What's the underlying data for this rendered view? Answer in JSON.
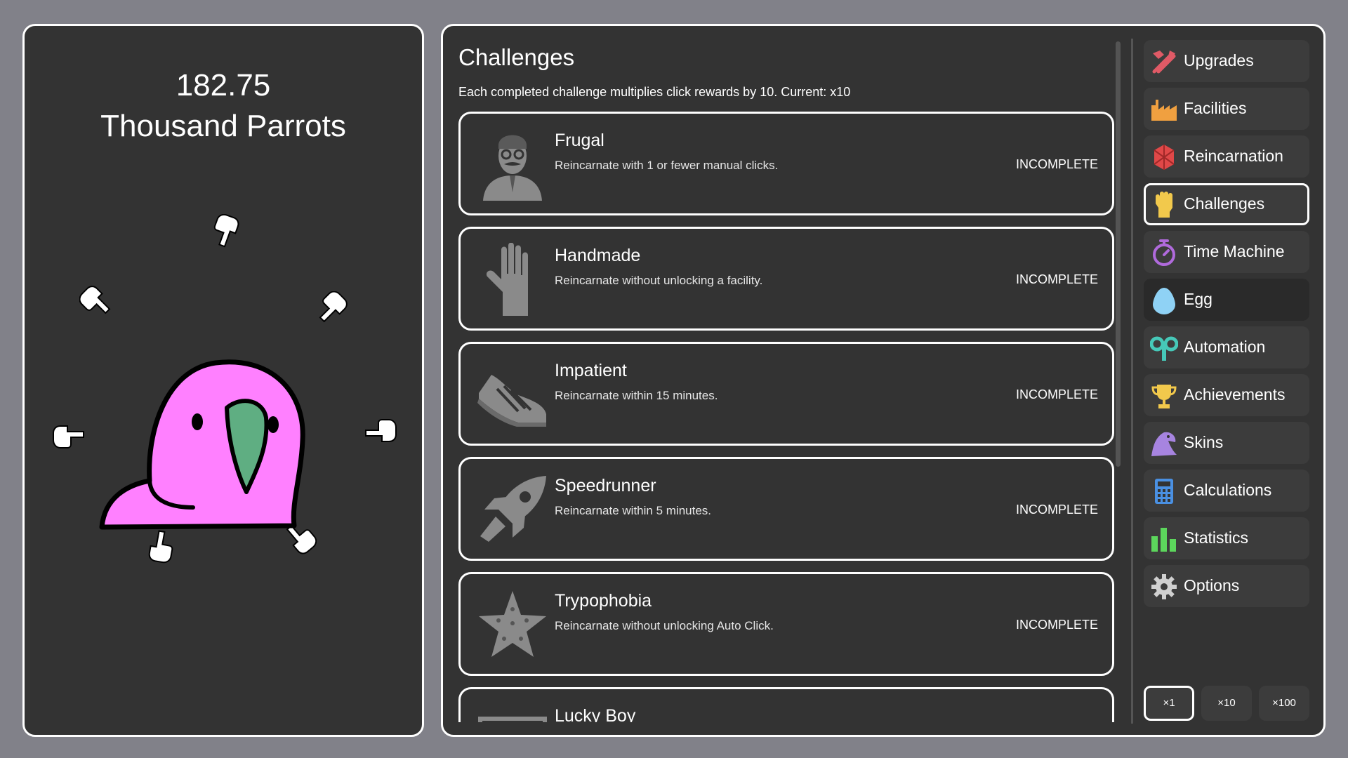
{
  "counter": {
    "value": "182.75",
    "unit": "Thousand Parrots"
  },
  "challenges": {
    "title": "Challenges",
    "description": "Each completed challenge multiplies click rewards by 10. Current: x10",
    "items": [
      {
        "name": "Frugal",
        "description": "Reincarnate with 1 or fewer manual clicks.",
        "status": "INCOMPLETE",
        "icon": "man-with-glasses-icon"
      },
      {
        "name": "Handmade",
        "description": "Reincarnate without unlocking a facility.",
        "status": "INCOMPLETE",
        "icon": "hand-icon"
      },
      {
        "name": "Impatient",
        "description": "Reincarnate within 15 minutes.",
        "status": "INCOMPLETE",
        "icon": "sneaker-icon"
      },
      {
        "name": "Speedrunner",
        "description": "Reincarnate within 5 minutes.",
        "status": "INCOMPLETE",
        "icon": "rocket-icon"
      },
      {
        "name": "Trypophobia",
        "description": "Reincarnate without unlocking Auto Click.",
        "status": "INCOMPLETE",
        "icon": "starfish-icon"
      },
      {
        "name": "Lucky Boy",
        "description": "",
        "status": "",
        "icon": "banknote-icon"
      }
    ]
  },
  "nav": {
    "items": [
      {
        "label": "Upgrades",
        "icon": "hammer-wrench-icon",
        "color": "#e05a66"
      },
      {
        "label": "Facilities",
        "icon": "factory-icon",
        "color": "#f0a040"
      },
      {
        "label": "Reincarnation",
        "icon": "gem-icon",
        "color": "#e04848"
      },
      {
        "label": "Challenges",
        "icon": "fist-icon",
        "color": "#f2c94c"
      },
      {
        "label": "Time Machine",
        "icon": "stopwatch-icon",
        "color": "#b06adc"
      },
      {
        "label": "Egg",
        "icon": "egg-icon",
        "color": "#8fd2f5"
      },
      {
        "label": "Automation",
        "icon": "windup-key-icon",
        "color": "#46c8b8"
      },
      {
        "label": "Achievements",
        "icon": "trophy-icon",
        "color": "#f2c94c"
      },
      {
        "label": "Skins",
        "icon": "bird-head-icon",
        "color": "#a784e0"
      },
      {
        "label": "Calculations",
        "icon": "calculator-icon",
        "color": "#4a90e2"
      },
      {
        "label": "Statistics",
        "icon": "bar-chart-icon",
        "color": "#5cd65c"
      },
      {
        "label": "Options",
        "icon": "gear-icon",
        "color": "#d0d0d0"
      }
    ],
    "active": "Challenges"
  },
  "multipliers": {
    "items": [
      "×1",
      "×10",
      "×100"
    ],
    "active": "×1"
  },
  "colors": {
    "panel": "#333333",
    "background": "#818189",
    "parrot": "#ff80ff",
    "beak": "#5fae82"
  }
}
